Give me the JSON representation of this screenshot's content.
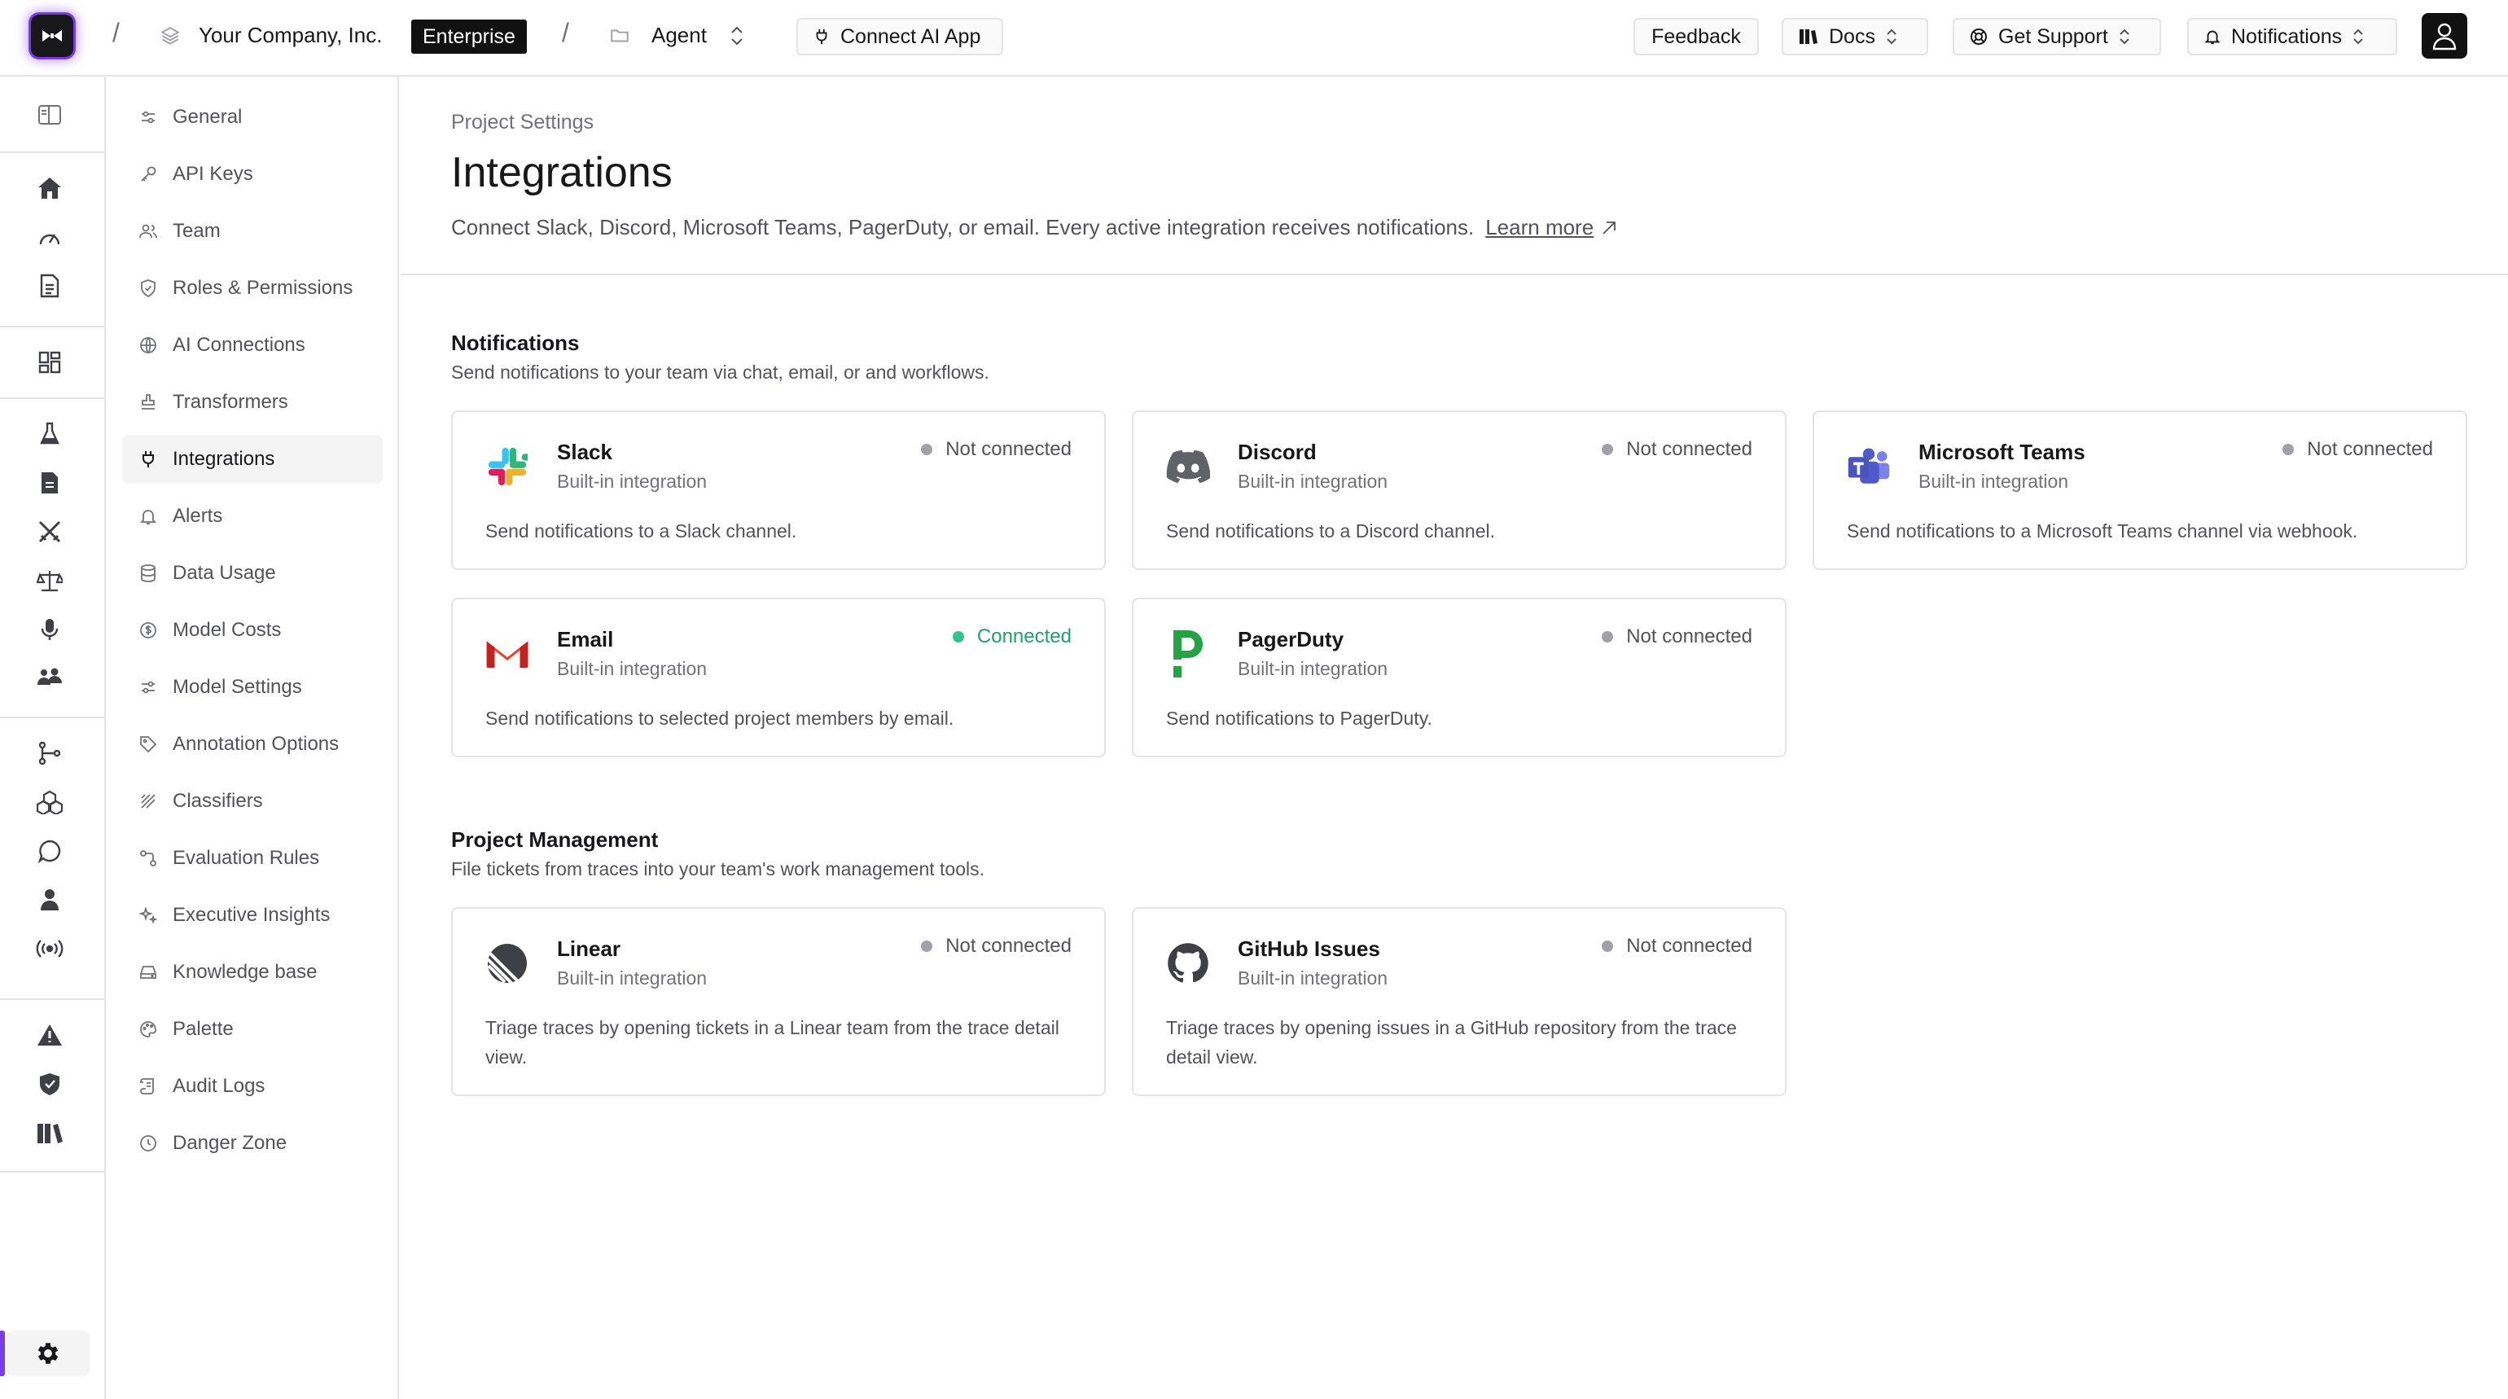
{
  "topbar": {
    "org_name": "Your Company, Inc.",
    "plan_badge": "Enterprise",
    "project_name": "Agent",
    "connect_ai_label": "Connect AI App",
    "feedback_label": "Feedback",
    "docs_label": "Docs",
    "support_label": "Get Support",
    "notifications_label": "Notifications",
    "separator": "/"
  },
  "rail": {
    "icons": [
      "sidebar-toggle-icon",
      "home-icon",
      "gauge-icon",
      "document-icon",
      "dashboard-icon",
      "flask-icon",
      "file-icon",
      "swords-icon",
      "scale-icon",
      "microphone-icon",
      "users-group-icon",
      "git-branch-icon",
      "cubes-icon",
      "chat-icon",
      "person-icon",
      "broadcast-icon",
      "alert-icon",
      "shield-icon",
      "library-icon",
      "settings-icon"
    ]
  },
  "settings_nav": {
    "items": [
      {
        "label": "General",
        "icon": "sliders-icon"
      },
      {
        "label": "API Keys",
        "icon": "key-icon"
      },
      {
        "label": "Team",
        "icon": "users-icon"
      },
      {
        "label": "Roles & Permissions",
        "icon": "shield-check-icon"
      },
      {
        "label": "AI Connections",
        "icon": "globe-icon"
      },
      {
        "label": "Transformers",
        "icon": "stamp-icon"
      },
      {
        "label": "Integrations",
        "icon": "plug-icon"
      },
      {
        "label": "Alerts",
        "icon": "bell-icon"
      },
      {
        "label": "Data Usage",
        "icon": "database-icon"
      },
      {
        "label": "Model Costs",
        "icon": "dollar-circle-icon"
      },
      {
        "label": "Model Settings",
        "icon": "sliders-alt-icon"
      },
      {
        "label": "Annotation Options",
        "icon": "tag-icon"
      },
      {
        "label": "Classifiers",
        "icon": "sparkle-lines-icon"
      },
      {
        "label": "Evaluation Rules",
        "icon": "rules-icon"
      },
      {
        "label": "Executive Insights",
        "icon": "sparkles-icon"
      },
      {
        "label": "Knowledge base",
        "icon": "drive-icon"
      },
      {
        "label": "Palette",
        "icon": "palette-icon"
      },
      {
        "label": "Audit Logs",
        "icon": "scroll-icon"
      },
      {
        "label": "Danger Zone",
        "icon": "danger-clock-icon"
      }
    ],
    "active": "Integrations"
  },
  "main": {
    "breadcrumb": "Project Settings",
    "title": "Integrations",
    "description": "Connect Slack, Discord, Microsoft Teams, PagerDuty, or email. Every active integration receives notifications.",
    "learn_more": "Learn more",
    "sections": {
      "notifications": {
        "title": "Notifications",
        "subtitle": "Send notifications to your team via chat, email, or and workflows.",
        "cards": [
          {
            "name": "Slack",
            "kind": "Built-in integration",
            "status": "Not connected",
            "description": "Send notifications to a Slack channel."
          },
          {
            "name": "Discord",
            "kind": "Built-in integration",
            "status": "Not connected",
            "description": "Send notifications to a Discord channel."
          },
          {
            "name": "Microsoft Teams",
            "kind": "Built-in integration",
            "status": "Not connected",
            "description": "Send notifications to a Microsoft Teams channel via webhook."
          },
          {
            "name": "Email",
            "kind": "Built-in integration",
            "status": "Connected",
            "description": "Send notifications to selected project members by email."
          },
          {
            "name": "PagerDuty",
            "kind": "Built-in integration",
            "status": "Not connected",
            "description": "Send notifications to PagerDuty."
          }
        ]
      },
      "project_management": {
        "title": "Project Management",
        "subtitle": "File tickets from traces into your team's work management tools.",
        "cards": [
          {
            "name": "Linear",
            "kind": "Built-in integration",
            "status": "Not connected",
            "description": "Triage traces by opening tickets in a Linear team from the trace detail view."
          },
          {
            "name": "GitHub Issues",
            "kind": "Built-in integration",
            "status": "Not connected",
            "description": "Triage traces by opening issues in a GitHub repository from the trace detail view."
          }
        ]
      }
    }
  },
  "colors": {
    "accent": "#7c3aed",
    "connected": "#22a06b",
    "not_connected_dot": "#a1a1aa",
    "border": "#e4e4e7"
  }
}
